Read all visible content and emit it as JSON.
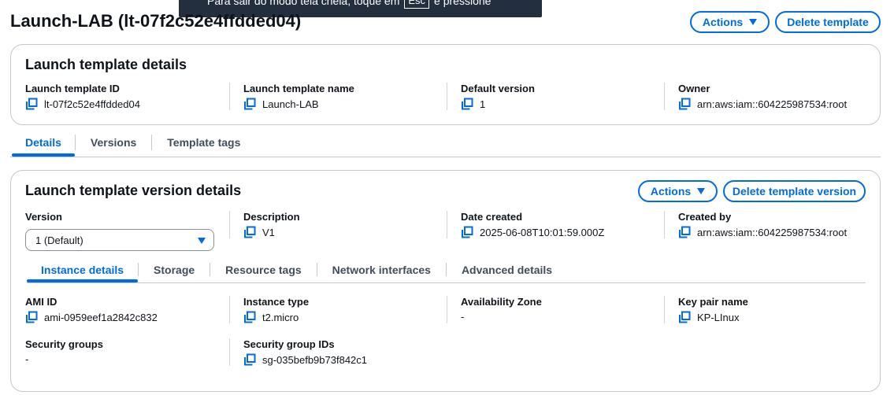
{
  "toast": {
    "text_before": "Para sair do modo tela cheia, toque em",
    "key": "Esc",
    "text_after": "e pressione"
  },
  "page": {
    "title": "Launch-LAB (lt-07f2c52e4ffdded04)"
  },
  "header": {
    "actions_label": "Actions",
    "delete_label": "Delete template"
  },
  "details": {
    "title": "Launch template details",
    "fields": [
      {
        "label": "Launch template ID",
        "value": "lt-07f2c52e4ffdded04"
      },
      {
        "label": "Launch template name",
        "value": "Launch-LAB"
      },
      {
        "label": "Default version",
        "value": "1"
      },
      {
        "label": "Owner",
        "value": "arn:aws:iam::604225987534:root"
      }
    ]
  },
  "tabs": [
    "Details",
    "Versions",
    "Template tags"
  ],
  "version_details": {
    "title": "Launch template version details",
    "actions_label": "Actions",
    "delete_label": "Delete template version",
    "version_label": "Version",
    "version_selected": "1 (Default)",
    "fields": [
      {
        "label": "Description",
        "value": "V1"
      },
      {
        "label": "Date created",
        "value": "2025-06-08T10:01:59.000Z"
      },
      {
        "label": "Created by",
        "value": "arn:aws:iam::604225987534:root"
      }
    ],
    "subtabs": [
      "Instance details",
      "Storage",
      "Resource tags",
      "Network interfaces",
      "Advanced details"
    ],
    "instance": {
      "ami_label": "AMI ID",
      "ami_value": "ami-0959eef1a2842c832",
      "type_label": "Instance type",
      "type_value": "t2.micro",
      "az_label": "Availability Zone",
      "az_value": "-",
      "key_label": "Key pair name",
      "key_value": "KP-LInux",
      "sg_label": "Security groups",
      "sg_value": "-",
      "sgid_label": "Security group IDs",
      "sgid_value": "sg-035befb9b73f842c1"
    }
  },
  "colors": {
    "accent": "#006ce0",
    "border": "#c6c6cd",
    "text": "#0f141a",
    "tab_inactive": "#414d5c"
  }
}
